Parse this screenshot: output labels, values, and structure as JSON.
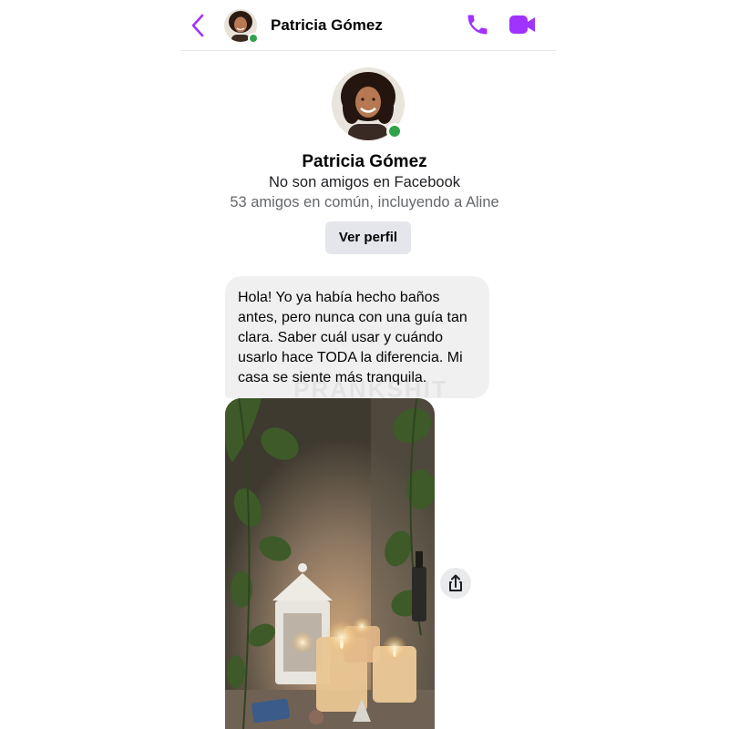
{
  "header": {
    "contact_name": "Patricia Gómez",
    "icons": [
      "back-chevron-icon",
      "phone-icon",
      "video-camera-icon"
    ],
    "accent_color": "#a033ff",
    "online_color": "#31a24c"
  },
  "profile": {
    "name": "Patricia Gómez",
    "friendship_status": "No son amigos en Facebook",
    "mutual_friends": "53 amigos en común, incluyendo a Aline",
    "view_profile_label": "Ver perfil"
  },
  "messages": [
    {
      "type": "text",
      "text": "Hola! Yo ya había hecho baños antes, pero nunca con una guía tan clara. Saber cuál usar y cuándo usarlo hace TODA la diferencia. Mi casa se siente más tranquila."
    },
    {
      "type": "image",
      "description_icon": "candles-plants-photo",
      "share_icon": "share-icon"
    }
  ],
  "watermark": "PRANKSHIT"
}
